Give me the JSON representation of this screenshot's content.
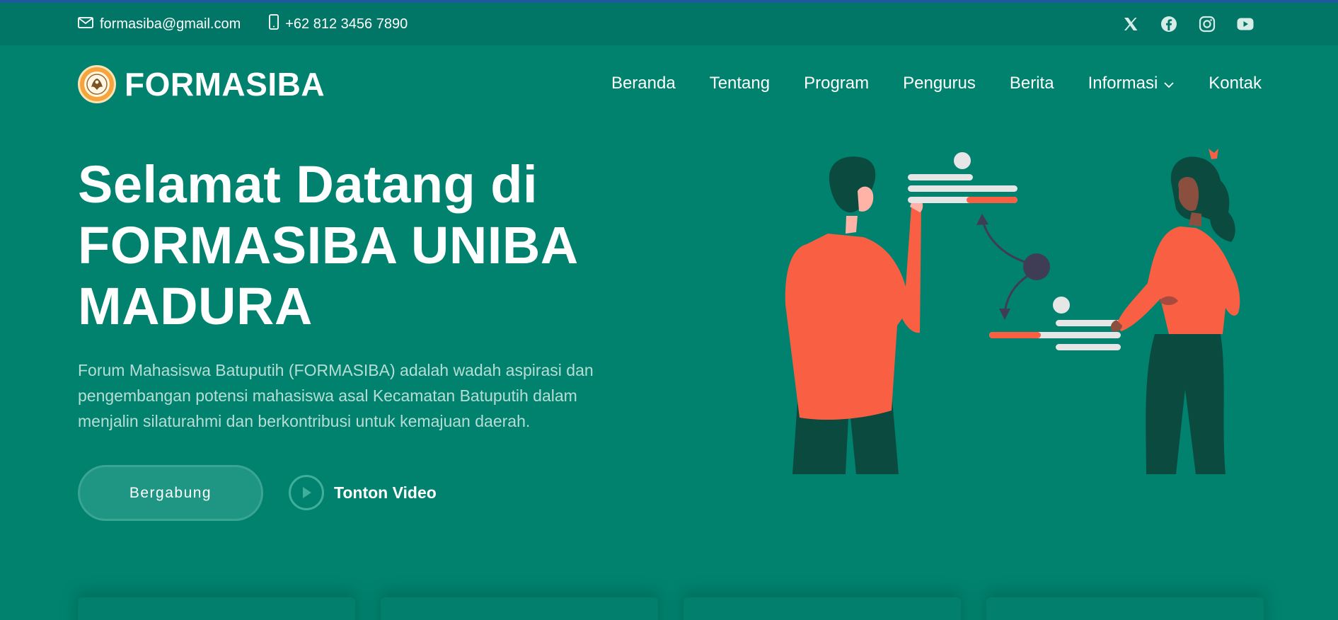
{
  "topbar": {
    "email": "formasiba@gmail.com",
    "phone": "+62 812 3456 7890",
    "social_icons": [
      "x-icon",
      "facebook-icon",
      "instagram-icon",
      "youtube-icon"
    ]
  },
  "brand": {
    "name": "FORMASIBA"
  },
  "nav": {
    "items": [
      {
        "label": "Beranda"
      },
      {
        "label": "Tentang"
      },
      {
        "label": "Program"
      },
      {
        "label": "Pengurus"
      },
      {
        "label": "Berita"
      },
      {
        "label": "Informasi",
        "has_dropdown": true
      },
      {
        "label": "Kontak"
      }
    ]
  },
  "hero": {
    "title_lines": [
      "Selamat Datang di",
      "FORMASIBA UNIBA",
      "MADURA"
    ],
    "description": "Forum Mahasiswa Batuputih (FORMASIBA) adalah wadah aspirasi dan pengembangan potensi mahasiswa asal Kecamatan Batuputih dalam menjalin silaturahmi dan berkontribusi untuk kemajuan daerah.",
    "join_label": "Bergabung",
    "video_label": "Tonton Video"
  },
  "colors": {
    "background": "#00826f",
    "topbar": "#017566",
    "accent": "#f96043",
    "dark_green": "#0b4a3f"
  }
}
